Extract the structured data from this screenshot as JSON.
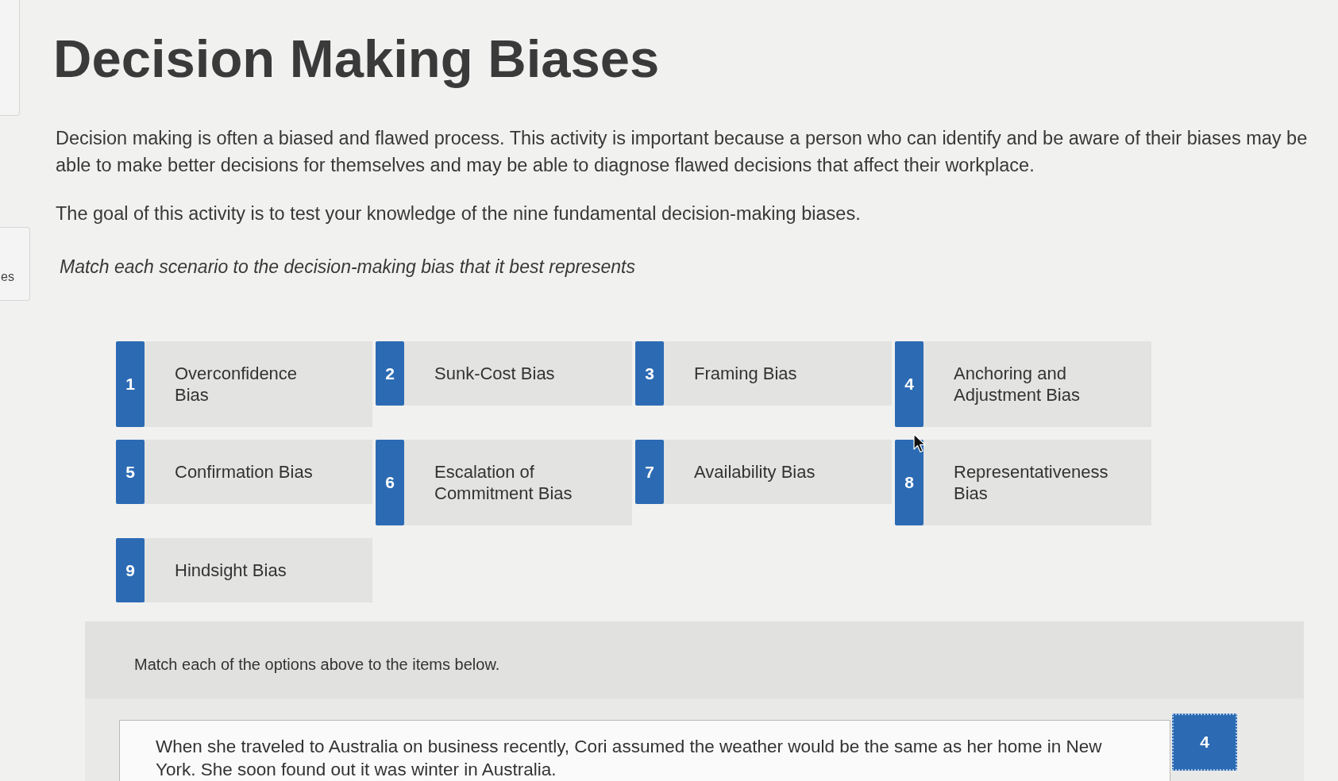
{
  "side_panel": {
    "tab_label": "es"
  },
  "title": "Decision Making Biases",
  "intro": [
    "Decision making is often a biased and flawed process. This activity is important because a person who can identify and be aware of their biases may be able to make better decisions for themselves and may be able to diagnose flawed decisions that affect their workplace.",
    "The goal of this activity is to test your knowledge of the nine fundamental decision-making biases."
  ],
  "instruction": "Match each scenario to the decision-making bias that it best represents",
  "options": [
    {
      "number": "1",
      "label": "Overconfidence Bias"
    },
    {
      "number": "2",
      "label": "Sunk-Cost Bias"
    },
    {
      "number": "3",
      "label": "Framing Bias"
    },
    {
      "number": "4",
      "label": "Anchoring and Adjustment Bias"
    },
    {
      "number": "5",
      "label": "Confirmation Bias"
    },
    {
      "number": "6",
      "label": "Escalation of Commitment Bias"
    },
    {
      "number": "7",
      "label": "Availability Bias"
    },
    {
      "number": "8",
      "label": "Representativeness Bias"
    },
    {
      "number": "9",
      "label": "Hindsight Bias"
    }
  ],
  "matching": {
    "header": "Match each of the options above to the items below.",
    "items": [
      {
        "scenario": "When she traveled to Australia on business recently, Cori assumed the weather would be the same as her home in New York. She soon found out it was winter in Australia.",
        "answer": "4"
      }
    ]
  }
}
